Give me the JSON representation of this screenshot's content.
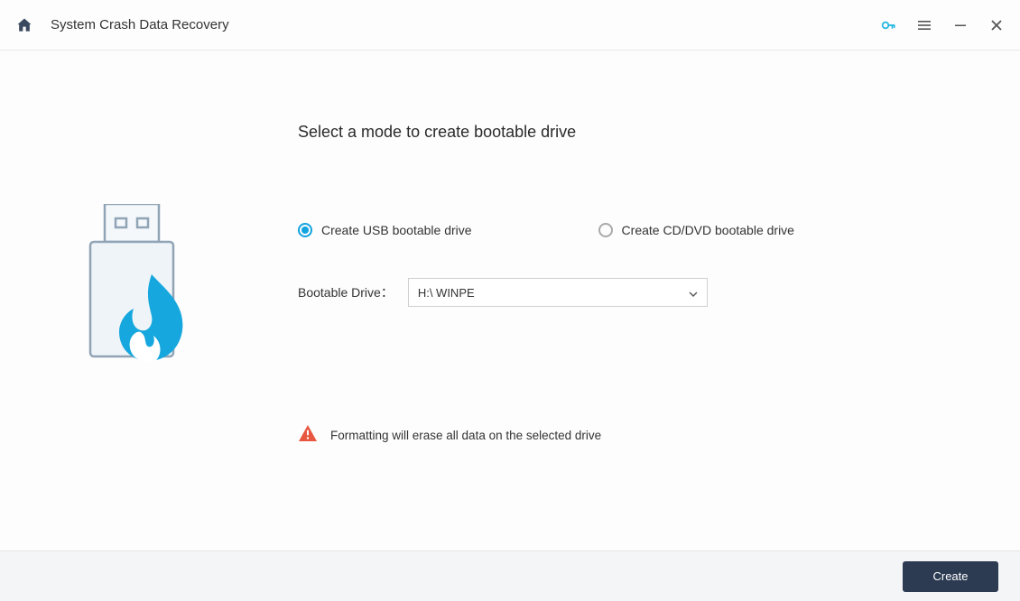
{
  "titlebar": {
    "title": "System Crash Data Recovery"
  },
  "main": {
    "heading": "Select a mode to create bootable drive",
    "options": {
      "usb": "Create USB bootable drive",
      "cd": "Create CD/DVD bootable drive"
    },
    "drive_label": "Bootable Drive：",
    "drive_value": "H:\\ WINPE",
    "warning": "Formatting will erase all data on the selected drive"
  },
  "footer": {
    "create_label": "Create"
  }
}
